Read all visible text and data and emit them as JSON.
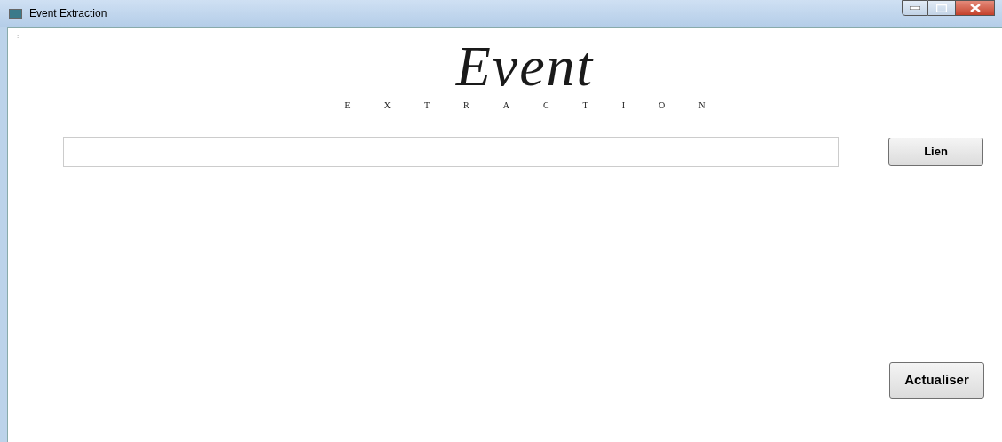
{
  "window": {
    "title": "Event Extraction"
  },
  "corner_mark": ":",
  "logo": {
    "script": "Event",
    "tagline": "EXTRACTION"
  },
  "buttons": [
    {
      "label": "Lien"
    },
    {
      "label": "Actualiser"
    }
  ]
}
